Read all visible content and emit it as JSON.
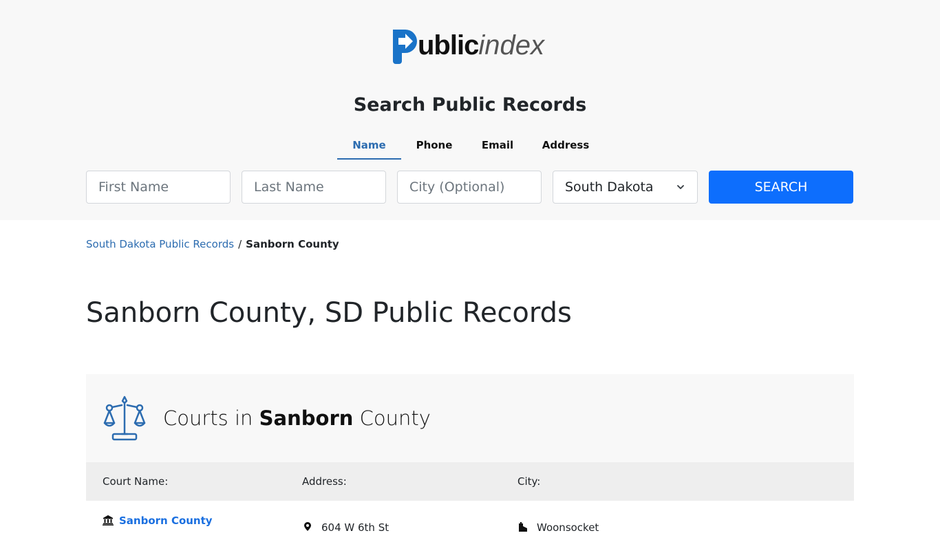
{
  "logo": {
    "bold_part": "ublic",
    "light_part": "index",
    "brand_color": "#1a73c8"
  },
  "search": {
    "title": "Search Public Records",
    "tabs": [
      {
        "label": "Name",
        "active": true
      },
      {
        "label": "Phone",
        "active": false
      },
      {
        "label": "Email",
        "active": false
      },
      {
        "label": "Address",
        "active": false
      }
    ],
    "first_name_placeholder": "First Name",
    "last_name_placeholder": "Last Name",
    "city_placeholder": "City (Optional)",
    "state_selected": "South Dakota",
    "button_label": "SEARCH",
    "button_color": "#0d6efd"
  },
  "breadcrumb": {
    "parent": "South Dakota Public Records",
    "separator": "/",
    "current": "Sanborn County"
  },
  "page_title": "Sanborn County, SD Public Records",
  "courts": {
    "title_prefix": "Courts in",
    "title_bold": "Sanborn",
    "title_suffix": "County",
    "columns": [
      "Court Name:",
      "Address:",
      "City:"
    ],
    "rows": [
      {
        "name": "Sanborn County",
        "address": "604 W 6th St",
        "city": "Woonsocket"
      }
    ]
  },
  "icons": {
    "logo_mark": "arrow-p-icon",
    "scales": "scales-of-justice-icon",
    "court": "courthouse-icon",
    "address": "map-pin-icon",
    "city": "city-building-icon",
    "select": "chevron-down-icon"
  }
}
